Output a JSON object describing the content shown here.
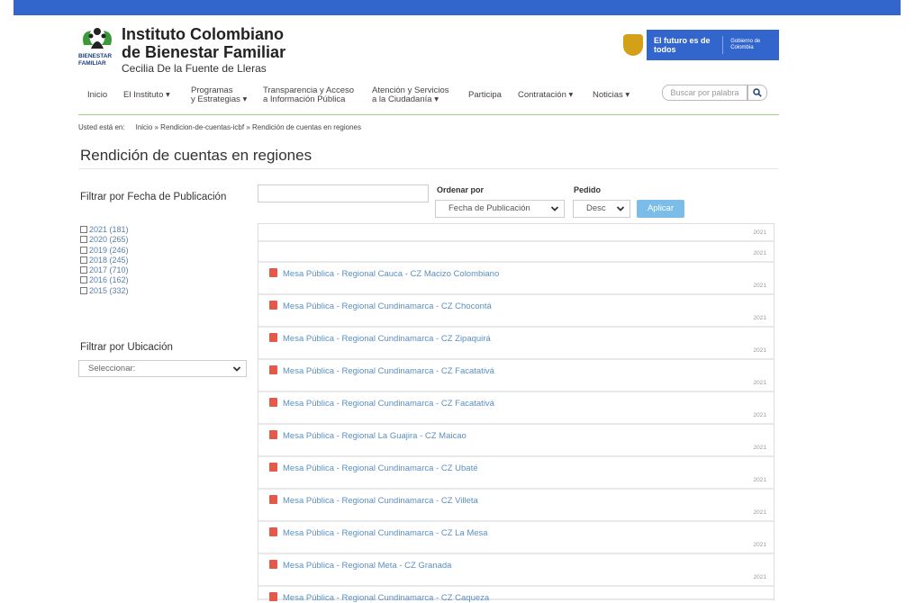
{
  "header": {
    "brand_line1": "Instituto Colombiano",
    "brand_line2": "de Bienestar Familiar",
    "brand_line3": "Cecilia De la Fuente de Lleras",
    "logo_text": "BIENESTAR FAMILIAR",
    "gov_futuro": "El futuro es de todos",
    "gov_gobierno": "Gobierno de Colombia"
  },
  "nav": {
    "items": [
      {
        "label": "Inicio"
      },
      {
        "label": "El Instituto ▾"
      },
      {
        "label": "Programas",
        "label2": "y Estrategias ▾"
      },
      {
        "label": "Transparencia y Acceso",
        "label2": "a Información Pública"
      },
      {
        "label": "Atención y Servicios",
        "label2": "a la Ciudadanía  ▾"
      },
      {
        "label": "Participa"
      },
      {
        "label": "Contratación ▾"
      },
      {
        "label": "Noticias ▾"
      }
    ],
    "search_placeholder": "Buscar por palabra"
  },
  "breadcrumb": {
    "label": "Usted está en:",
    "path": "Inicio » Rendicion-de-cuentas-icbf » Rendición de cuentas en regiones"
  },
  "page_title": "Rendición de cuentas en regiones",
  "filters": {
    "date_title": "Filtrar por Fecha de Publicación",
    "years": [
      "2021 (181)",
      "2020 (265)",
      "2019 (246)",
      "2018 (245)",
      "2017 (710)",
      "2016 (162)",
      "2015 (332)"
    ],
    "location_title": "Filtrar por Ubicación",
    "location_value": "Seleccionar:"
  },
  "controls": {
    "order_label": "Ordenar por",
    "order_value": "Fecha de Publicación",
    "dir_label": "Pedido",
    "dir_value": "Desc",
    "apply_label": "Aplicar"
  },
  "results": [
    {
      "title": "",
      "year": "2021"
    },
    {
      "title": "",
      "year": "2021"
    },
    {
      "title": "Mesa Pública - Regional Cauca - CZ Macizo Colombiano",
      "year": "2021"
    },
    {
      "title": "Mesa Pública - Regional Cundinamarca - CZ Chocontá",
      "year": "2021"
    },
    {
      "title": "Mesa Pública - Regional Cundinamarca - CZ Zipaquirá",
      "year": "2021"
    },
    {
      "title": "Mesa Pública - Regional Cundinamarca - CZ Facatativá",
      "year": "2021"
    },
    {
      "title": "Mesa Pública - Regional Cundinamarca - CZ Facatativá",
      "year": "2021"
    },
    {
      "title": "Mesa Pública - Regional La Guajira - CZ Maicao",
      "year": "2021"
    },
    {
      "title": "Mesa Pública - Regional Cundinamarca - CZ Ubaté",
      "year": "2021"
    },
    {
      "title": "Mesa Pública - Regional Cundinamarca - CZ Villeta",
      "year": "2021"
    },
    {
      "title": "Mesa Pública - Regional Cundinamarca - CZ La Mesa",
      "year": "2021"
    },
    {
      "title": "Mesa Pública - Regional Meta - CZ Granada",
      "year": "2021"
    },
    {
      "title": "Mesa Pública - Regional Cundinamarca - CZ Caqueza",
      "year": ""
    }
  ]
}
